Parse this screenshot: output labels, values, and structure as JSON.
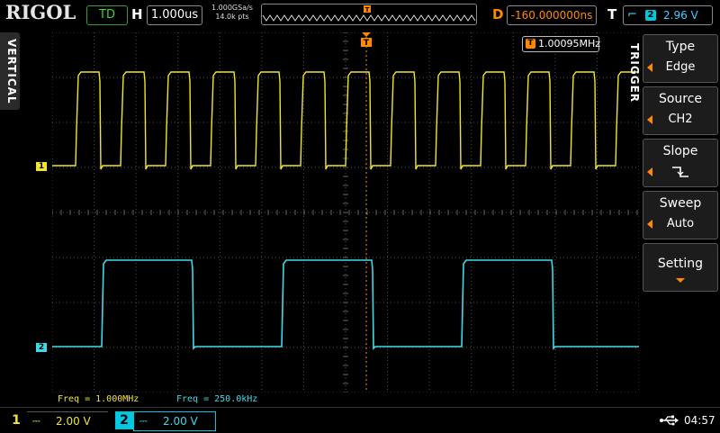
{
  "header": {
    "brand": "RIGOL",
    "run_state": "TD",
    "horizontal_label": "H",
    "timebase": "1.000us",
    "sample_rate": "1.000GSa/s",
    "memory_points": "14.0k pts",
    "delay_label": "D",
    "delay_value": "-160.000000ns",
    "trigger_label": "T",
    "trigger_source": "2",
    "trigger_level": "2.96 V",
    "trigger_badge": "T",
    "slope_icon": "falling-edge-icon"
  },
  "left_panel": {
    "title": "VERTICAL"
  },
  "scope": {
    "ch1_marker": "1",
    "ch2_marker": "2",
    "freq_badge": "T",
    "freq_counter": "1.00095MHz",
    "measurements": [
      {
        "text": "Freq = 1.000MHz"
      },
      {
        "text": "Freq = 250.0kHz"
      }
    ],
    "ch1_color": "#f0e62a",
    "ch2_color": "#3fd9e8",
    "trigger_color": "#ff8a00"
  },
  "menu": {
    "title": "TRIGGER",
    "items": [
      {
        "label": "Type",
        "value": "Edge"
      },
      {
        "label": "Source",
        "value": "CH2"
      },
      {
        "label": "Slope",
        "value": "falling-edge-icon"
      },
      {
        "label": "Sweep",
        "value": "Auto"
      },
      {
        "label": "Setting",
        "value": ""
      }
    ]
  },
  "footer": {
    "ch1_label": "1",
    "ch1_scale": "2.00 V",
    "ch2_label": "2",
    "ch2_scale": "2.00 V",
    "coupling_icon": "dc-coupling-icon",
    "usb_icon": "usb-icon",
    "time": "04:57"
  }
}
